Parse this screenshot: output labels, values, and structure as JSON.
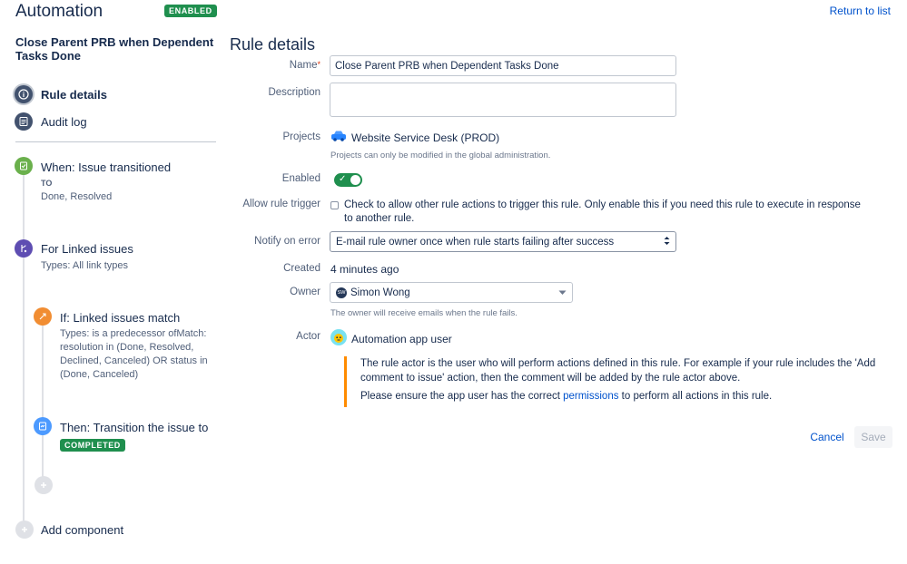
{
  "header": {
    "title": "Automation",
    "status_badge": "ENABLED",
    "return_link": "Return to list"
  },
  "sidebar": {
    "rule_name": "Close Parent PRB when Dependent Tasks Done",
    "nav": [
      {
        "label": "Rule details",
        "icon": "info-icon",
        "active": true
      },
      {
        "label": "Audit log",
        "icon": "list-icon",
        "active": false
      }
    ],
    "components": {
      "trigger": {
        "title": "When: Issue transitioned",
        "to_label": "TO",
        "detail": "Done, Resolved"
      },
      "branch": {
        "title": "For Linked issues",
        "detail": "Types: All link types"
      },
      "condition": {
        "title": "If: Linked issues match",
        "detail": "Types: is a predecessor ofMatch: resolution in (Done, Resolved, Declined, Canceled) OR status in (Done, Canceled)"
      },
      "action": {
        "title": "Then: Transition the issue to",
        "badge": "COMPLETED"
      },
      "add_component": "Add component"
    }
  },
  "main": {
    "title": "Rule details",
    "fields": {
      "name_label": "Name",
      "name_value": "Close Parent PRB when Dependent Tasks Done",
      "description_label": "Description",
      "description_value": "",
      "projects_label": "Projects",
      "projects_value": "Website Service Desk (PROD)",
      "projects_help": "Projects can only be modified in the global administration.",
      "enabled_label": "Enabled",
      "allow_trigger_label": "Allow rule trigger",
      "allow_trigger_text": "Check to allow other rule actions to trigger this rule. Only enable this if you need this rule to execute in response to another rule.",
      "notify_label": "Notify on error",
      "notify_value": "E-mail rule owner once when rule starts failing after success",
      "created_label": "Created",
      "created_value": "4 minutes ago",
      "owner_label": "Owner",
      "owner_initials": "SW",
      "owner_value": "Simon Wong",
      "owner_help": "The owner will receive emails when the rule fails.",
      "actor_label": "Actor",
      "actor_value": "Automation app user",
      "actor_note_1": "The rule actor is the user who will perform actions defined in this rule. For example if your rule includes the 'Add comment to issue' action, then the comment will be added by the rule actor above.",
      "actor_note_2_pre": "Please ensure the app user has the correct ",
      "actor_note_2_link": "permissions",
      "actor_note_2_post": " to perform all actions in this rule."
    },
    "buttons": {
      "cancel": "Cancel",
      "save": "Save"
    }
  },
  "colors": {
    "green": "#1f8f4e",
    "link": "#0052CC",
    "warning": "#FF8B00",
    "trigger_icon": "#6ab04c",
    "branch_icon": "#5e4db2",
    "condition_icon": "#f18d32",
    "action_icon": "#4c9aff"
  }
}
